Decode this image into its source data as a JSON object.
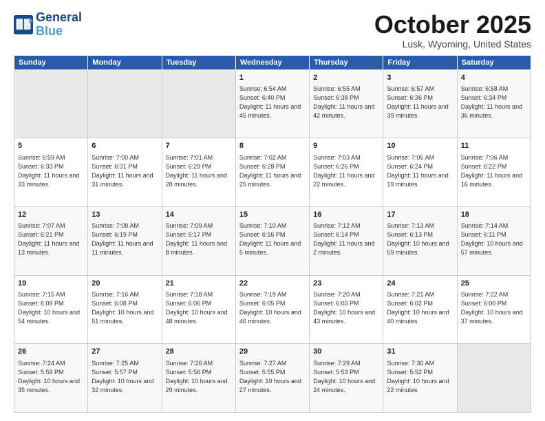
{
  "logo": {
    "line1": "General",
    "line2": "Blue"
  },
  "header": {
    "title": "October 2025",
    "location": "Lusk, Wyoming, United States"
  },
  "weekdays": [
    "Sunday",
    "Monday",
    "Tuesday",
    "Wednesday",
    "Thursday",
    "Friday",
    "Saturday"
  ],
  "weeks": [
    [
      {
        "day": "",
        "sunrise": "",
        "sunset": "",
        "daylight": ""
      },
      {
        "day": "",
        "sunrise": "",
        "sunset": "",
        "daylight": ""
      },
      {
        "day": "",
        "sunrise": "",
        "sunset": "",
        "daylight": ""
      },
      {
        "day": "1",
        "sunrise": "Sunrise: 6:54 AM",
        "sunset": "Sunset: 6:40 PM",
        "daylight": "Daylight: 11 hours and 45 minutes."
      },
      {
        "day": "2",
        "sunrise": "Sunrise: 6:55 AM",
        "sunset": "Sunset: 6:38 PM",
        "daylight": "Daylight: 11 hours and 42 minutes."
      },
      {
        "day": "3",
        "sunrise": "Sunrise: 6:57 AM",
        "sunset": "Sunset: 6:36 PM",
        "daylight": "Daylight: 11 hours and 39 minutes."
      },
      {
        "day": "4",
        "sunrise": "Sunrise: 6:58 AM",
        "sunset": "Sunset: 6:34 PM",
        "daylight": "Daylight: 11 hours and 36 minutes."
      }
    ],
    [
      {
        "day": "5",
        "sunrise": "Sunrise: 6:59 AM",
        "sunset": "Sunset: 6:33 PM",
        "daylight": "Daylight: 11 hours and 33 minutes."
      },
      {
        "day": "6",
        "sunrise": "Sunrise: 7:00 AM",
        "sunset": "Sunset: 6:31 PM",
        "daylight": "Daylight: 11 hours and 31 minutes."
      },
      {
        "day": "7",
        "sunrise": "Sunrise: 7:01 AM",
        "sunset": "Sunset: 6:29 PM",
        "daylight": "Daylight: 11 hours and 28 minutes."
      },
      {
        "day": "8",
        "sunrise": "Sunrise: 7:02 AM",
        "sunset": "Sunset: 6:28 PM",
        "daylight": "Daylight: 11 hours and 25 minutes."
      },
      {
        "day": "9",
        "sunrise": "Sunrise: 7:03 AM",
        "sunset": "Sunset: 6:26 PM",
        "daylight": "Daylight: 11 hours and 22 minutes."
      },
      {
        "day": "10",
        "sunrise": "Sunrise: 7:05 AM",
        "sunset": "Sunset: 6:24 PM",
        "daylight": "Daylight: 11 hours and 19 minutes."
      },
      {
        "day": "11",
        "sunrise": "Sunrise: 7:06 AM",
        "sunset": "Sunset: 6:22 PM",
        "daylight": "Daylight: 11 hours and 16 minutes."
      }
    ],
    [
      {
        "day": "12",
        "sunrise": "Sunrise: 7:07 AM",
        "sunset": "Sunset: 6:21 PM",
        "daylight": "Daylight: 11 hours and 13 minutes."
      },
      {
        "day": "13",
        "sunrise": "Sunrise: 7:08 AM",
        "sunset": "Sunset: 6:19 PM",
        "daylight": "Daylight: 11 hours and 11 minutes."
      },
      {
        "day": "14",
        "sunrise": "Sunrise: 7:09 AM",
        "sunset": "Sunset: 6:17 PM",
        "daylight": "Daylight: 11 hours and 8 minutes."
      },
      {
        "day": "15",
        "sunrise": "Sunrise: 7:10 AM",
        "sunset": "Sunset: 6:16 PM",
        "daylight": "Daylight: 11 hours and 5 minutes."
      },
      {
        "day": "16",
        "sunrise": "Sunrise: 7:12 AM",
        "sunset": "Sunset: 6:14 PM",
        "daylight": "Daylight: 11 hours and 2 minutes."
      },
      {
        "day": "17",
        "sunrise": "Sunrise: 7:13 AM",
        "sunset": "Sunset: 6:13 PM",
        "daylight": "Daylight: 10 hours and 59 minutes."
      },
      {
        "day": "18",
        "sunrise": "Sunrise: 7:14 AM",
        "sunset": "Sunset: 6:11 PM",
        "daylight": "Daylight: 10 hours and 57 minutes."
      }
    ],
    [
      {
        "day": "19",
        "sunrise": "Sunrise: 7:15 AM",
        "sunset": "Sunset: 6:09 PM",
        "daylight": "Daylight: 10 hours and 54 minutes."
      },
      {
        "day": "20",
        "sunrise": "Sunrise: 7:16 AM",
        "sunset": "Sunset: 6:08 PM",
        "daylight": "Daylight: 10 hours and 51 minutes."
      },
      {
        "day": "21",
        "sunrise": "Sunrise: 7:18 AM",
        "sunset": "Sunset: 6:06 PM",
        "daylight": "Daylight: 10 hours and 48 minutes."
      },
      {
        "day": "22",
        "sunrise": "Sunrise: 7:19 AM",
        "sunset": "Sunset: 6:05 PM",
        "daylight": "Daylight: 10 hours and 46 minutes."
      },
      {
        "day": "23",
        "sunrise": "Sunrise: 7:20 AM",
        "sunset": "Sunset: 6:03 PM",
        "daylight": "Daylight: 10 hours and 43 minutes."
      },
      {
        "day": "24",
        "sunrise": "Sunrise: 7:21 AM",
        "sunset": "Sunset: 6:02 PM",
        "daylight": "Daylight: 10 hours and 40 minutes."
      },
      {
        "day": "25",
        "sunrise": "Sunrise: 7:22 AM",
        "sunset": "Sunset: 6:00 PM",
        "daylight": "Daylight: 10 hours and 37 minutes."
      }
    ],
    [
      {
        "day": "26",
        "sunrise": "Sunrise: 7:24 AM",
        "sunset": "Sunset: 5:59 PM",
        "daylight": "Daylight: 10 hours and 35 minutes."
      },
      {
        "day": "27",
        "sunrise": "Sunrise: 7:25 AM",
        "sunset": "Sunset: 5:57 PM",
        "daylight": "Daylight: 10 hours and 32 minutes."
      },
      {
        "day": "28",
        "sunrise": "Sunrise: 7:26 AM",
        "sunset": "Sunset: 5:56 PM",
        "daylight": "Daylight: 10 hours and 29 minutes."
      },
      {
        "day": "29",
        "sunrise": "Sunrise: 7:27 AM",
        "sunset": "Sunset: 5:55 PM",
        "daylight": "Daylight: 10 hours and 27 minutes."
      },
      {
        "day": "30",
        "sunrise": "Sunrise: 7:29 AM",
        "sunset": "Sunset: 5:53 PM",
        "daylight": "Daylight: 10 hours and 24 minutes."
      },
      {
        "day": "31",
        "sunrise": "Sunrise: 7:30 AM",
        "sunset": "Sunset: 5:52 PM",
        "daylight": "Daylight: 10 hours and 22 minutes."
      },
      {
        "day": "",
        "sunrise": "",
        "sunset": "",
        "daylight": ""
      }
    ]
  ]
}
